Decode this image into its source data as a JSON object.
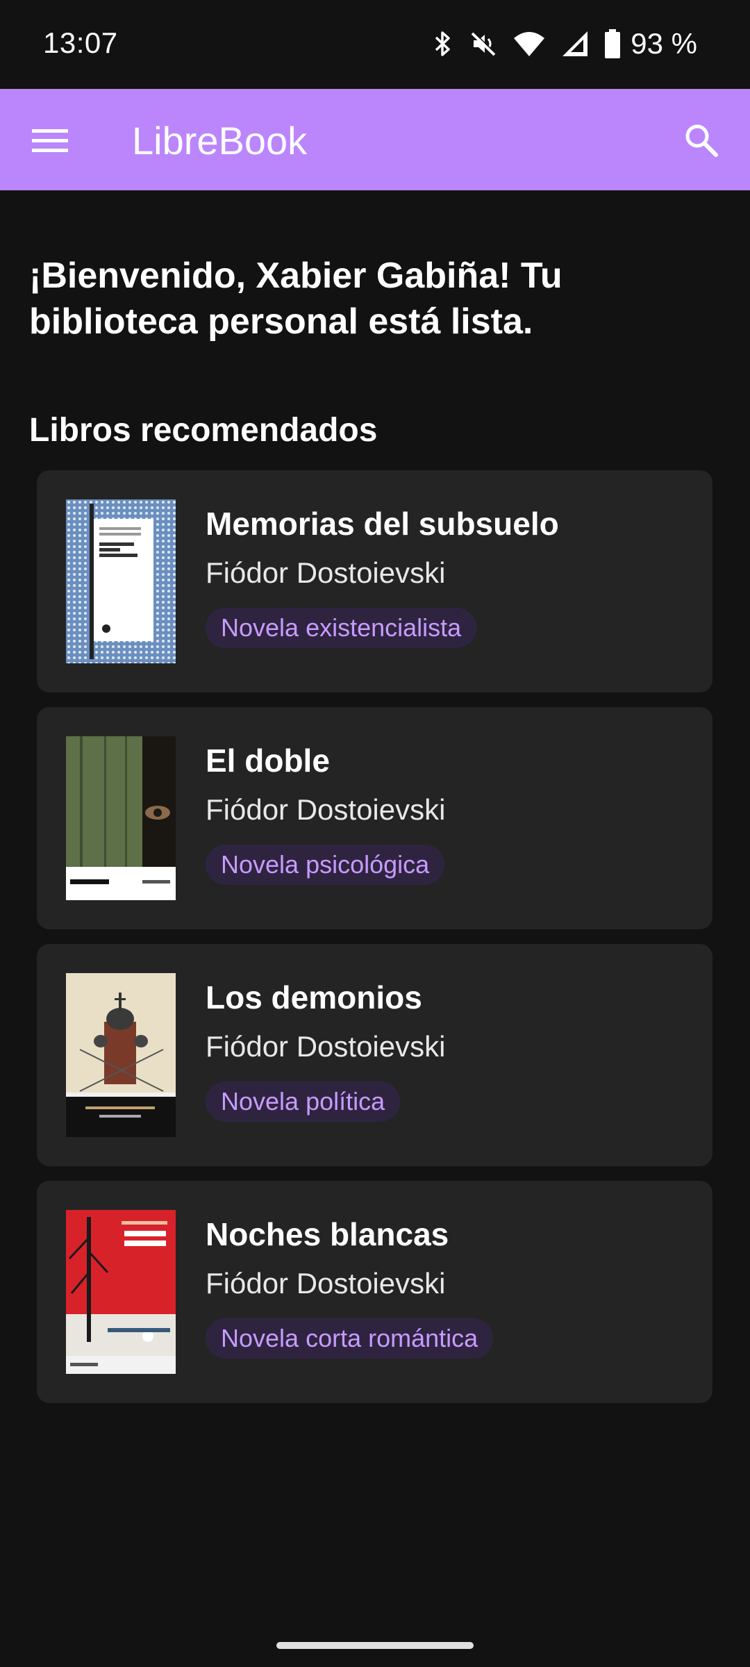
{
  "status_bar": {
    "time": "13:07",
    "battery": "93 %",
    "icons": [
      "bluetooth-icon",
      "mute-icon",
      "wifi-icon",
      "signal-icon",
      "battery-icon"
    ]
  },
  "app_bar": {
    "title": "LibreBook",
    "menu_icon": "menu-icon",
    "search_icon": "search-icon",
    "color": "#bb86fc"
  },
  "welcome_text": "¡Bienvenido, Xabier Gabiña! Tu biblioteca personal está lista.",
  "section_title": "Libros recomendados",
  "books": [
    {
      "title": "Memorias del subsuelo",
      "author": "Fiódor Dostoievski",
      "genre": "Novela existencialista"
    },
    {
      "title": "El doble",
      "author": "Fiódor Dostoievski",
      "genre": "Novela psicológica"
    },
    {
      "title": "Los demonios",
      "author": "Fiódor Dostoievski",
      "genre": "Novela política"
    },
    {
      "title": "Noches blancas",
      "author": "Fiódor Dostoievski",
      "genre": "Novela corta romántica"
    }
  ],
  "colors": {
    "background": "#121212",
    "card": "#242424",
    "chip_background": "#2f2440",
    "chip_text": "#c79bff"
  }
}
